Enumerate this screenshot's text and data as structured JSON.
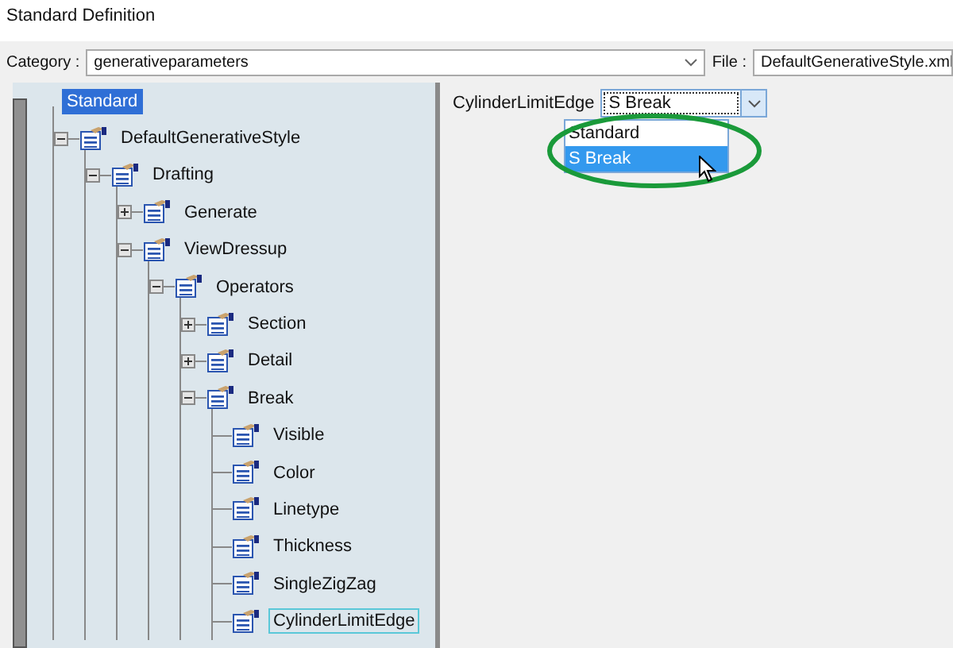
{
  "window": {
    "title": "Standard Definition"
  },
  "category": {
    "label": "Category :",
    "value": "generativeparameters"
  },
  "file": {
    "label": "File :",
    "value": "DefaultGenerativeStyle.xml"
  },
  "tree": [
    {
      "label": "Standard",
      "selected": true,
      "focused": false,
      "children": [
        {
          "label": "DefaultGenerativeStyle",
          "selected": false,
          "focused": false,
          "expanded": true,
          "children": [
            {
              "label": "Drafting",
              "selected": false,
              "focused": false,
              "expanded": true,
              "children": [
                {
                  "label": "Generate",
                  "selected": false,
                  "focused": false,
                  "expanded": false
                },
                {
                  "label": "ViewDressup",
                  "selected": false,
                  "focused": false,
                  "expanded": true,
                  "children": [
                    {
                      "label": "Operators",
                      "selected": false,
                      "focused": false,
                      "expanded": true,
                      "children": [
                        {
                          "label": "Section",
                          "selected": false,
                          "focused": false,
                          "expanded": false
                        },
                        {
                          "label": "Detail",
                          "selected": false,
                          "focused": false,
                          "expanded": false
                        },
                        {
                          "label": "Break",
                          "selected": false,
                          "focused": false,
                          "expanded": true,
                          "children": [
                            {
                              "label": "Visible",
                              "selected": false,
                              "focused": false
                            },
                            {
                              "label": "Color",
                              "selected": false,
                              "focused": false
                            },
                            {
                              "label": "Linetype",
                              "selected": false,
                              "focused": false
                            },
                            {
                              "label": "Thickness",
                              "selected": false,
                              "focused": false
                            },
                            {
                              "label": "SingleZigZag",
                              "selected": false,
                              "focused": false
                            },
                            {
                              "label": "CylinderLimitEdge",
                              "selected": false,
                              "focused": true
                            }
                          ]
                        }
                      ]
                    }
                  ]
                }
              ]
            }
          ]
        }
      ]
    }
  ],
  "parameter": {
    "label": "CylinderLimitEdge",
    "value": "S Break",
    "options": [
      {
        "label": "Standard",
        "selected": false
      },
      {
        "label": "S Break",
        "selected": true
      }
    ]
  }
}
